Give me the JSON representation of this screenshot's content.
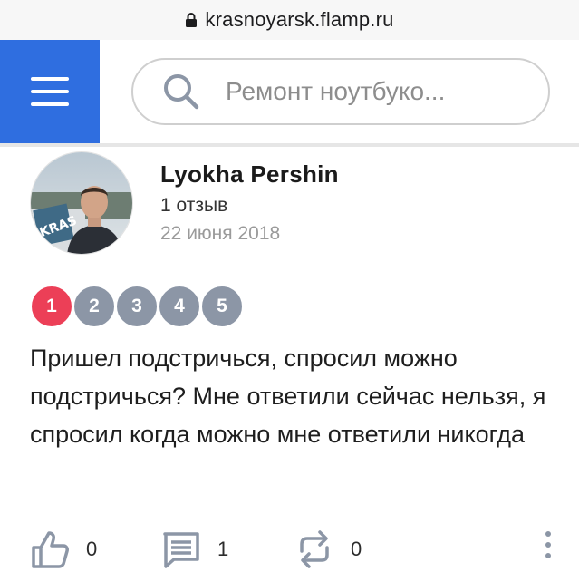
{
  "browser": {
    "url": "krasnoyarsk.flamp.ru"
  },
  "header": {
    "search_placeholder": "Ремонт ноутбуко..."
  },
  "review": {
    "author": {
      "name": "Lyokha Pershin",
      "reviews_count": "1 отзыв",
      "date": "22 июня 2018"
    },
    "rating": {
      "value": 1,
      "scale": [
        "1",
        "2",
        "3",
        "4",
        "5"
      ]
    },
    "text": "Пришел подстричься, спросил можно подстричься? Мне ответили сейчас нельзя, я спросил когда можно мне ответили никогда",
    "actions": {
      "likes": "0",
      "comments": "1",
      "reposts": "0"
    }
  },
  "colors": {
    "menu_bg": "#2f6ee0",
    "rating_active": "#ec3f57",
    "rating_inactive": "#8c96a6",
    "icon_gray": "#8c96a6"
  },
  "icons": [
    "lock-icon",
    "hamburger-menu-icon",
    "search-icon",
    "thumbs-up-icon",
    "comment-icon",
    "repost-icon",
    "more-vertical-icon"
  ]
}
